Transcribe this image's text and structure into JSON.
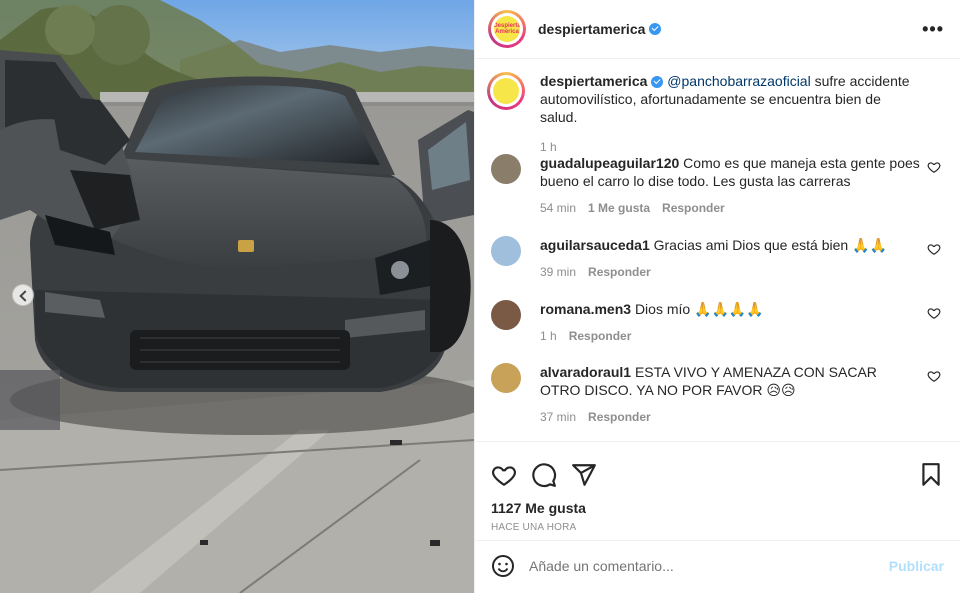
{
  "post": {
    "username": "despiertamerica",
    "avatar_text": "Despierta América",
    "caption": {
      "username": "despiertamerica",
      "mention": "@panchobarrazaoficial",
      "text": " sufre accidente automovilístico, afortunadamente se encuentra bien de salud.",
      "time": "1 h"
    },
    "comments": [
      {
        "username": "guadalupeaguilar120",
        "text": "Como es que maneja esta gente poes bueno el carro lo dise todo. Les gusta las carreras",
        "time": "54 min",
        "likes": "1 Me gusta",
        "reply": "Responder",
        "avatar_color": "#8a7d6a"
      },
      {
        "username": "aguilarsauceda1",
        "text": "Gracias ami Dios que está bien 🙏🙏",
        "time": "39 min",
        "reply": "Responder",
        "avatar_color": "#9fbfdc"
      },
      {
        "username": "romana.men3",
        "text": "Dios mío 🙏🙏🙏🙏",
        "time": "1 h",
        "reply": "Responder",
        "avatar_color": "#7a5a45"
      },
      {
        "username": "alvaradoraul1",
        "text": "ESTA VIVO Y AMENAZA CON SACAR OTRO DISCO. YA NO POR FAVOR 😥😥",
        "time": "37 min",
        "reply": "Responder",
        "avatar_color": "#c9a25a"
      }
    ],
    "likes": "1127 Me gusta",
    "date": "HACE UNA HORA",
    "comment_placeholder": "Añade un comentario...",
    "publish_label": "Publicar"
  },
  "colors": {
    "verified": "#3897f0",
    "mention": "#00376b",
    "publish_disabled": "#b2dffc"
  },
  "icons": [
    "more-options-icon",
    "heart-icon",
    "comment-icon",
    "share-icon",
    "bookmark-icon",
    "emoji-icon",
    "verified-icon",
    "carousel-prev-icon"
  ]
}
